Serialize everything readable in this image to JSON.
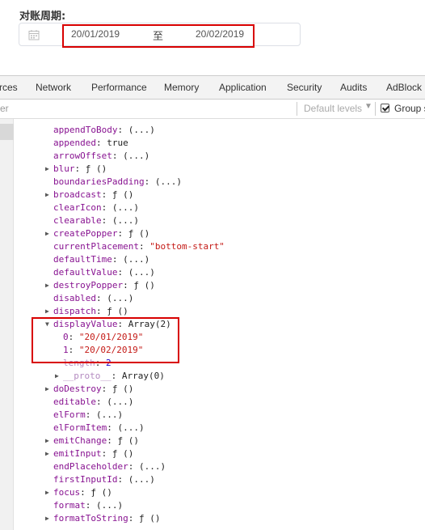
{
  "date_picker": {
    "label": "对账周期:",
    "start": "20/01/2019",
    "separator": "至",
    "end": "20/02/2019"
  },
  "devtools": {
    "tabs": [
      "rces",
      "Network",
      "Performance",
      "Memory",
      "Application",
      "Security",
      "Audits",
      "AdBlock"
    ],
    "filter": {
      "text": "er",
      "levels": "Default levels",
      "group_label": "Group s",
      "group_checked": true
    }
  },
  "console_props": [
    {
      "key": "appendToBody",
      "sep": ": ",
      "val": "(...)",
      "type": "plain",
      "expandable": false
    },
    {
      "key": "appended",
      "sep": ": ",
      "val": "true",
      "type": "plain",
      "expandable": false
    },
    {
      "key": "arrowOffset",
      "sep": ": ",
      "val": "(...)",
      "type": "plain",
      "expandable": false
    },
    {
      "key": "blur",
      "sep": ": ",
      "val": "ƒ ()",
      "type": "plain",
      "expandable": true
    },
    {
      "key": "boundariesPadding",
      "sep": ": ",
      "val": "(...)",
      "type": "plain",
      "expandable": false
    },
    {
      "key": "broadcast",
      "sep": ": ",
      "val": "ƒ ()",
      "type": "plain",
      "expandable": true
    },
    {
      "key": "clearIcon",
      "sep": ": ",
      "val": "(...)",
      "type": "plain",
      "expandable": false
    },
    {
      "key": "clearable",
      "sep": ": ",
      "val": "(...)",
      "type": "plain",
      "expandable": false
    },
    {
      "key": "createPopper",
      "sep": ": ",
      "val": "ƒ ()",
      "type": "plain",
      "expandable": true
    },
    {
      "key": "currentPlacement",
      "sep": ": ",
      "val": "\"bottom-start\"",
      "type": "string",
      "expandable": false
    },
    {
      "key": "defaultTime",
      "sep": ": ",
      "val": "(...)",
      "type": "plain",
      "expandable": false
    },
    {
      "key": "defaultValue",
      "sep": ": ",
      "val": "(...)",
      "type": "plain",
      "expandable": false
    },
    {
      "key": "destroyPopper",
      "sep": ": ",
      "val": "ƒ ()",
      "type": "plain",
      "expandable": true
    },
    {
      "key": "disabled",
      "sep": ": ",
      "val": "(...)",
      "type": "plain",
      "expandable": false
    },
    {
      "key": "dispatch",
      "sep": ": ",
      "val": "ƒ ()",
      "type": "plain",
      "expandable": true
    },
    {
      "key": "displayValue",
      "sep": ": ",
      "val": "Array(2)",
      "type": "plain",
      "expanded": true,
      "expandable": true
    },
    {
      "key": "0",
      "sep": ": ",
      "val": "\"20/01/2019\"",
      "type": "string",
      "indent": 1,
      "expandable": false
    },
    {
      "key": "1",
      "sep": ": ",
      "val": "\"20/02/2019\"",
      "type": "string",
      "indent": 1,
      "expandable": false
    },
    {
      "key": "length",
      "sep": ": ",
      "val": "2",
      "type": "number",
      "indent": 1,
      "faded": true,
      "expandable": false
    },
    {
      "key": "__proto__",
      "sep": ": ",
      "val": "Array(0)",
      "type": "plain",
      "indent": 1,
      "faded": true,
      "expandable": true
    },
    {
      "key": "doDestroy",
      "sep": ": ",
      "val": "ƒ ()",
      "type": "plain",
      "expandable": true
    },
    {
      "key": "editable",
      "sep": ": ",
      "val": "(...)",
      "type": "plain",
      "expandable": false
    },
    {
      "key": "elForm",
      "sep": ": ",
      "val": "(...)",
      "type": "plain",
      "expandable": false
    },
    {
      "key": "elFormItem",
      "sep": ": ",
      "val": "(...)",
      "type": "plain",
      "expandable": false
    },
    {
      "key": "emitChange",
      "sep": ": ",
      "val": "ƒ ()",
      "type": "plain",
      "expandable": true
    },
    {
      "key": "emitInput",
      "sep": ": ",
      "val": "ƒ ()",
      "type": "plain",
      "expandable": true
    },
    {
      "key": "endPlaceholder",
      "sep": ": ",
      "val": "(...)",
      "type": "plain",
      "expandable": false
    },
    {
      "key": "firstInputId",
      "sep": ": ",
      "val": "(...)",
      "type": "plain",
      "expandable": false
    },
    {
      "key": "focus",
      "sep": ": ",
      "val": "ƒ ()",
      "type": "plain",
      "expandable": true
    },
    {
      "key": "format",
      "sep": ": ",
      "val": "(...)",
      "type": "plain",
      "expandable": false
    },
    {
      "key": "formatToString",
      "sep": ": ",
      "val": "ƒ ()",
      "type": "plain",
      "expandable": true
    }
  ]
}
